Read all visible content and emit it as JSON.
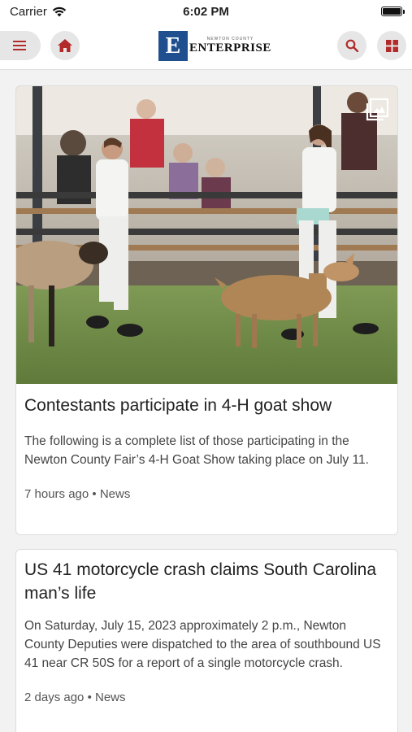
{
  "status": {
    "carrier": "Carrier",
    "time": "6:02 PM",
    "battery_level": 1.0
  },
  "header": {
    "logo_small": "NEWTON COUNTY",
    "logo_letter": "E",
    "logo_name": "ENTERPRISE",
    "icons": [
      "menu-icon",
      "home-icon",
      "search-icon",
      "grid-icon"
    ],
    "accent_color": "#b22a2a"
  },
  "articles": [
    {
      "title": "Contestants participate in 4-H goat show",
      "summary": "The following is a complete list of those participating in the Newton County Fair’s 4-H Goat Show taking place on July 11.",
      "time": "7 hours ago",
      "category": "News",
      "has_gallery": true
    },
    {
      "title": "US 41 motorcycle crash claims South Carolina man’s life",
      "summary": "On Saturday, July 15, 2023 approximately 2 p.m., Newton County Deputies were dispatched to the area of southbound US 41 near CR 50S for a report of a single motorcycle crash.",
      "time": "2 days ago",
      "category": "News"
    }
  ]
}
